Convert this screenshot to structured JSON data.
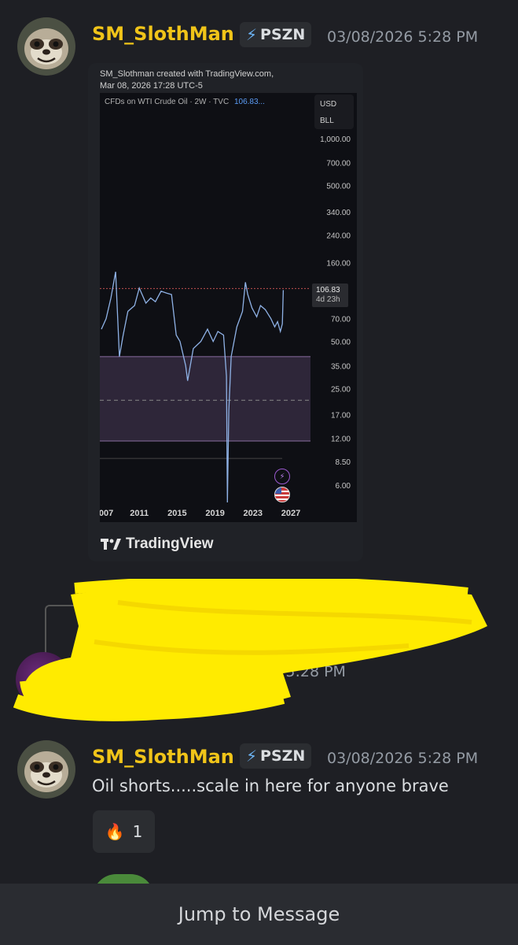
{
  "messages": [
    {
      "username": "SM_SlothMan",
      "badge": "PSZN",
      "timestamp": "03/08/2026 5:28 PM"
    },
    {
      "timestamp_partial": "/08/2026 5:28 PM"
    },
    {
      "username": "SM_SlothMan",
      "badge": "PSZN",
      "timestamp": "03/08/2026 5:28 PM",
      "text": "Oil shorts.....scale in here for anyone brave",
      "reaction": {
        "emoji": "🔥",
        "count": "1"
      }
    }
  ],
  "embed": {
    "header_line1": "SM_Slothman created with TradingView.com,",
    "header_line2": "Mar 08, 2026 17:28 UTC-5",
    "symbol": "CFDs on WTI Crude Oil · 2W · TVC",
    "symbol_price": "106.83...",
    "currency": "USD",
    "unit": "BLL",
    "price_label": "106.83",
    "countdown_label": "4d 23h",
    "brand": "TradingView"
  },
  "chart_data": {
    "type": "line",
    "title": "CFDs on WTI Crude Oil · 2W · TVC",
    "y_scale": "log",
    "y_ticks": [
      "1,000.00",
      "700.00",
      "500.00",
      "340.00",
      "240.00",
      "160.00",
      "70.00",
      "50.00",
      "35.00",
      "25.00",
      "17.00",
      "12.00",
      "8.50",
      "6.00"
    ],
    "x_ticks": [
      "007",
      "2011",
      "2015",
      "2019",
      "2023",
      "2027"
    ],
    "current_price": 106.83,
    "series": [
      {
        "x": [
          2007.0,
          2007.5,
          2008.0,
          2008.5,
          2008.9,
          2009.3,
          2009.8,
          2010.5,
          2011.0,
          2011.3,
          2011.7,
          2012.2,
          2012.7,
          2013.3,
          2013.9,
          2014.4,
          2014.9,
          2015.3,
          2015.9,
          2016.1,
          2016.7,
          2017.5,
          2018.2,
          2018.8,
          2019.3,
          2019.9,
          2020.2,
          2020.3,
          2020.45,
          2020.7,
          2021.3,
          2021.9,
          2022.2,
          2022.45,
          2022.9,
          2023.4,
          2023.8,
          2024.3,
          2024.9,
          2025.3,
          2025.6,
          2025.9,
          2026.1,
          2026.2
        ],
        "y": [
          60,
          70,
          95,
          140,
          40,
          55,
          78,
          85,
          110,
          100,
          88,
          95,
          90,
          105,
          102,
          100,
          55,
          50,
          35,
          28,
          45,
          50,
          60,
          50,
          58,
          55,
          30,
          0.01,
          18,
          40,
          62,
          78,
          120,
          100,
          82,
          72,
          85,
          80,
          70,
          62,
          67,
          58,
          65,
          106.83
        ]
      }
    ],
    "annotations": [
      "horizontal resistance line near 106.83",
      "shaded zone approx 11.5–40",
      "dashed mid line approx 21"
    ]
  },
  "footer": {
    "jump_label": "Jump to Message"
  }
}
